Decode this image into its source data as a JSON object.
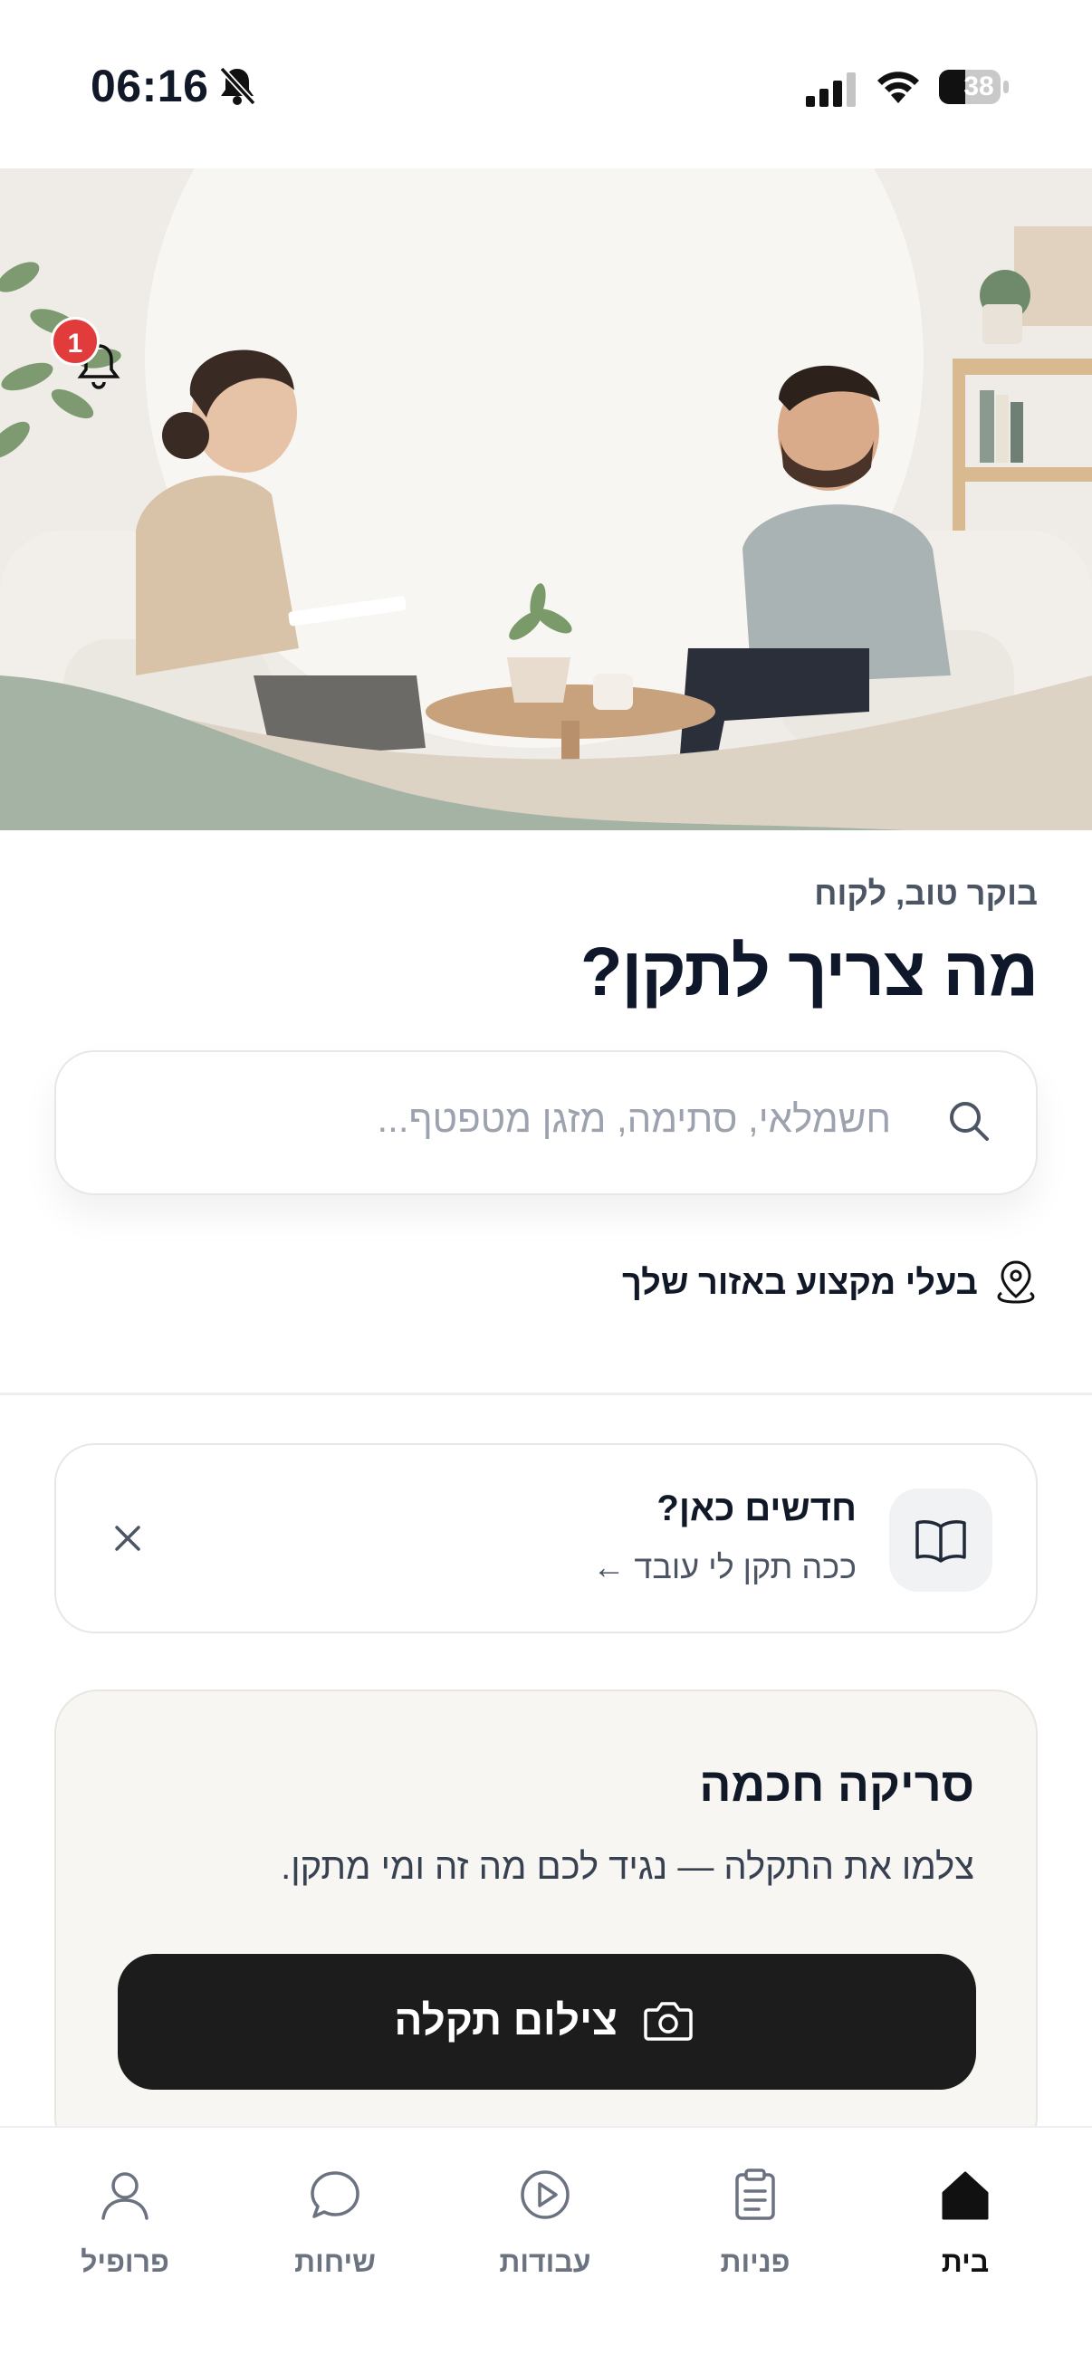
{
  "status_bar": {
    "time": "06:16",
    "battery": "38",
    "icons": [
      "bell-slash-icon",
      "signal-icon",
      "wifi-icon",
      "battery-icon"
    ]
  },
  "hero": {
    "notifications_count": "1",
    "illustration": "counselor-and-client-illustration"
  },
  "greeting": "בוקר טוב, לקוח",
  "headline": "מה צריך לתקן?",
  "search": {
    "placeholder": "חשמלאי, סתימה, מזגן מטפטף..."
  },
  "area_link": "בעלי מקצוע באזור שלך",
  "new_here": {
    "title": "חדשים כאן?",
    "subtitle": "ככה תקן לי עובד ←"
  },
  "smart_scan": {
    "title": "סריקה חכמה",
    "description": "צלמו את התקלה — נגיד לכם מה זה ומי מתקן.",
    "button_label": "צילום תקלה"
  },
  "nav": {
    "home": "בית",
    "requests": "פניות",
    "jobs": "עבודות",
    "chats": "שיחות",
    "profile": "פרופיל"
  },
  "colors": {
    "accent_dark": "#1c1c1c",
    "badge_red": "#e23b3b",
    "card_bg": "#f7f6f3",
    "hero_green": "#a5b3a5"
  }
}
